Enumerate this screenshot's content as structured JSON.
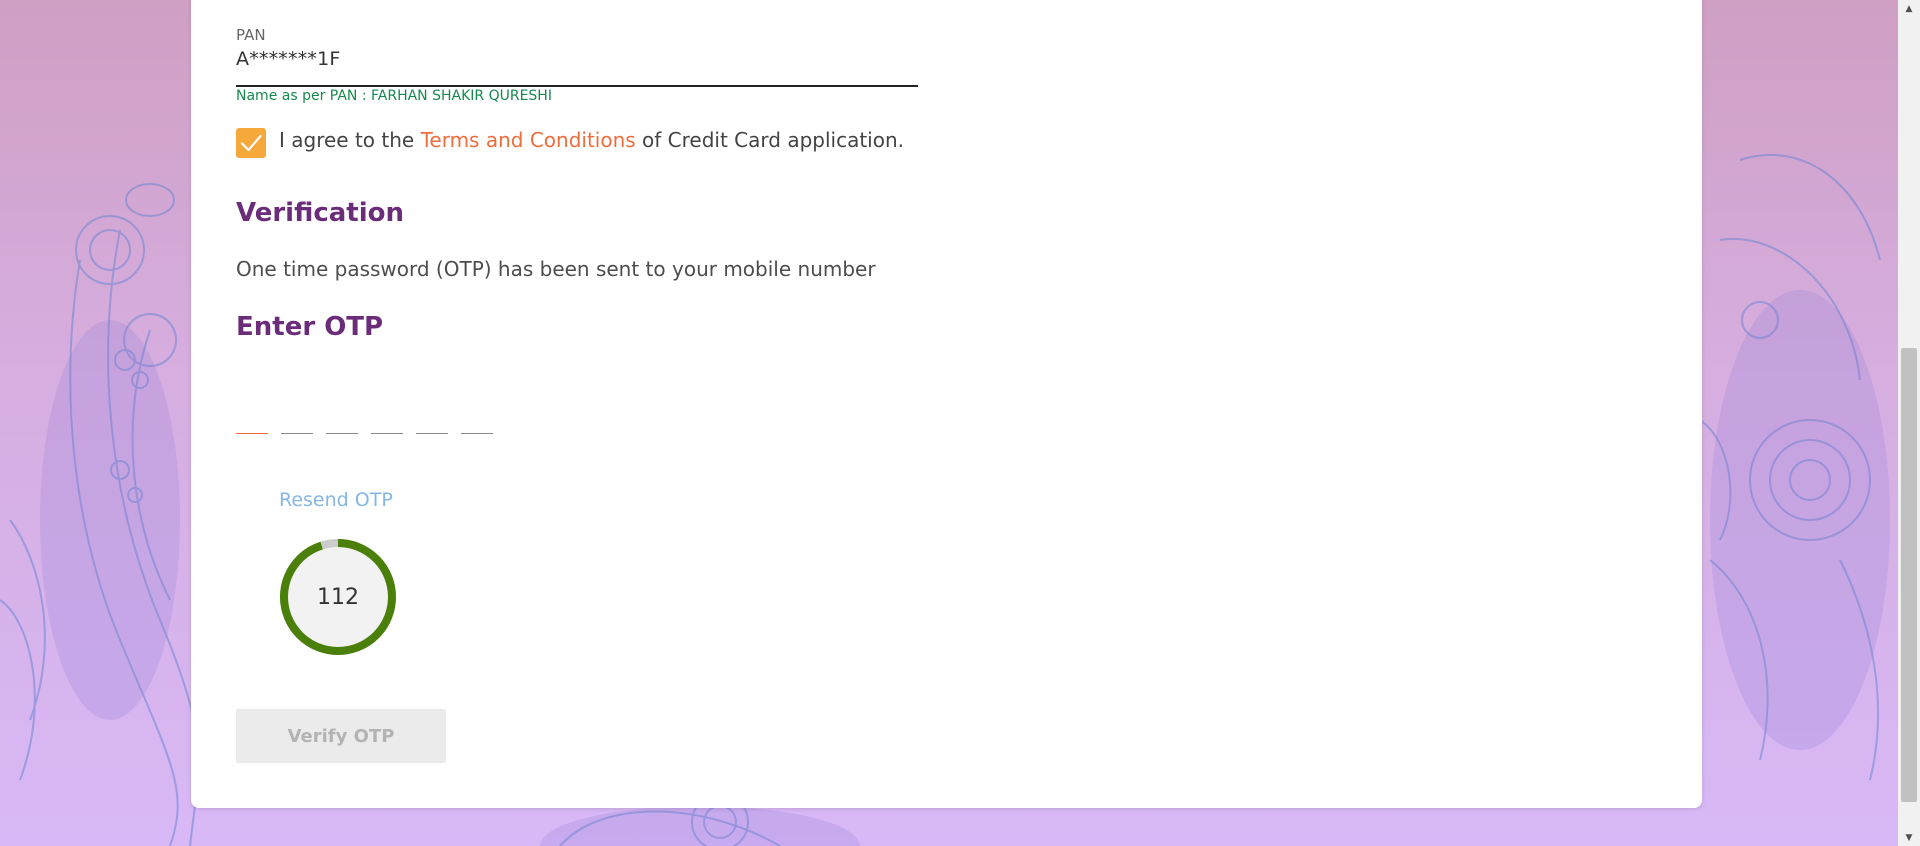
{
  "form": {
    "pan_label": "PAN",
    "pan_value": "A*******1F",
    "name_note": "Name as per PAN : FARHAN SHAKIR QURESHI",
    "terms_checked": true,
    "terms_prefix": "I agree to the ",
    "terms_link": "Terms and Conditions",
    "terms_suffix": " of Credit Card application."
  },
  "verification": {
    "heading": "Verification",
    "message": "One time password (OTP) has been sent to your mobile number",
    "enter_heading": "Enter OTP",
    "otp_digits": [
      "",
      "",
      "",
      "",
      "",
      ""
    ],
    "resend_label": "Resend OTP",
    "timer_value": "112",
    "timer_progress": 0.95,
    "verify_label": "Verify OTP"
  },
  "colors": {
    "accent_orange": "#f7a83b",
    "link_orange": "#ef6d3c",
    "heading_purple": "#6b2c79",
    "success_green": "#17894f",
    "timer_green": "#4a7f0a",
    "resend_blue": "#84b7e6"
  },
  "icons": {
    "checkbox": "check-icon",
    "scroll_up": "arrow-up-icon",
    "scroll_down": "arrow-down-icon"
  }
}
